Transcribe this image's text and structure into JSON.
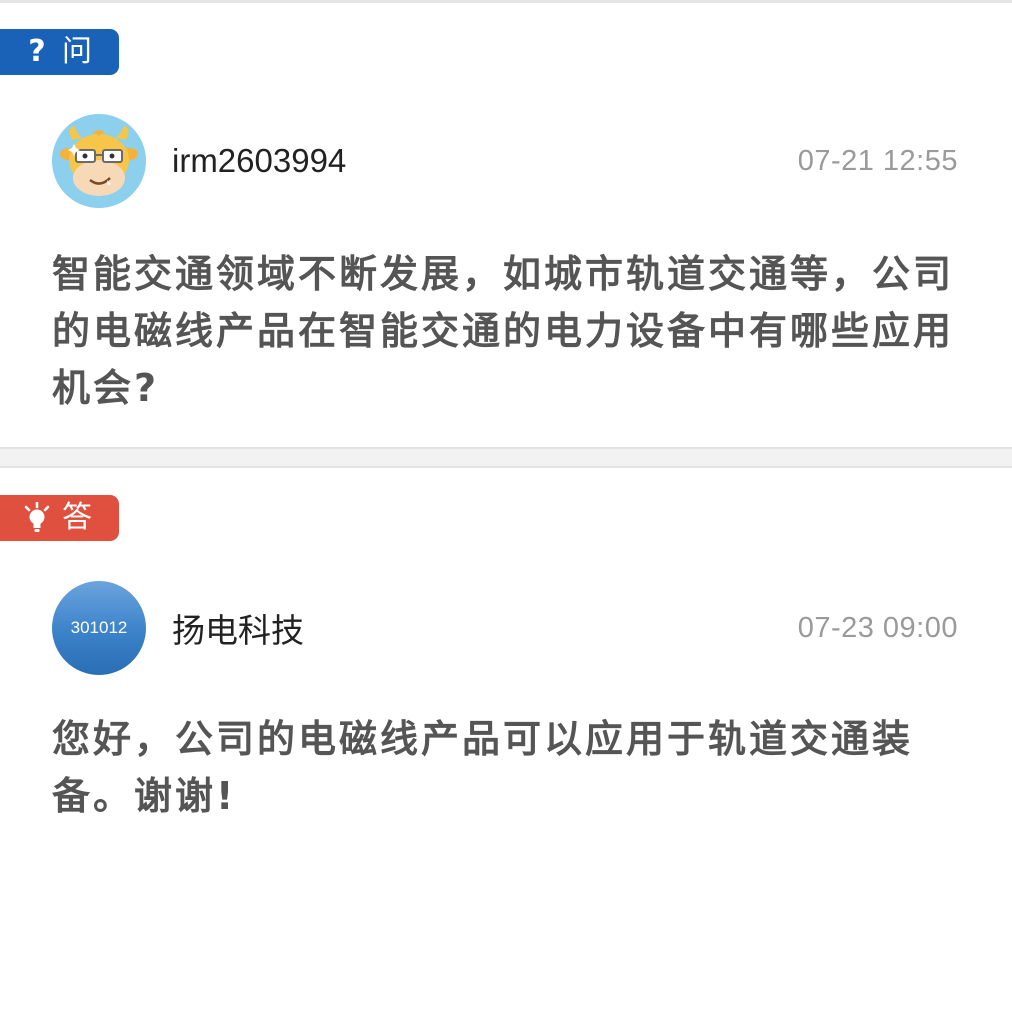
{
  "question": {
    "tag_label": "问",
    "tag_icon": "question-mark-icon",
    "tag_color": "#1a62b8",
    "author": "irm2603994",
    "time": "07-21 12:55",
    "content": "智能交通领域不断发展，如城市轨道交通等，公司的电磁线产品在智能交通的电力设备中有哪些应用机会?"
  },
  "answer": {
    "tag_label": "答",
    "tag_icon": "lightbulb-icon",
    "tag_color": "#e0503e",
    "avatar_text": "301012",
    "author": "扬电科技",
    "time": "07-23 09:00",
    "content": "您好，公司的电磁线产品可以应用于轨道交通装备。谢谢!"
  }
}
